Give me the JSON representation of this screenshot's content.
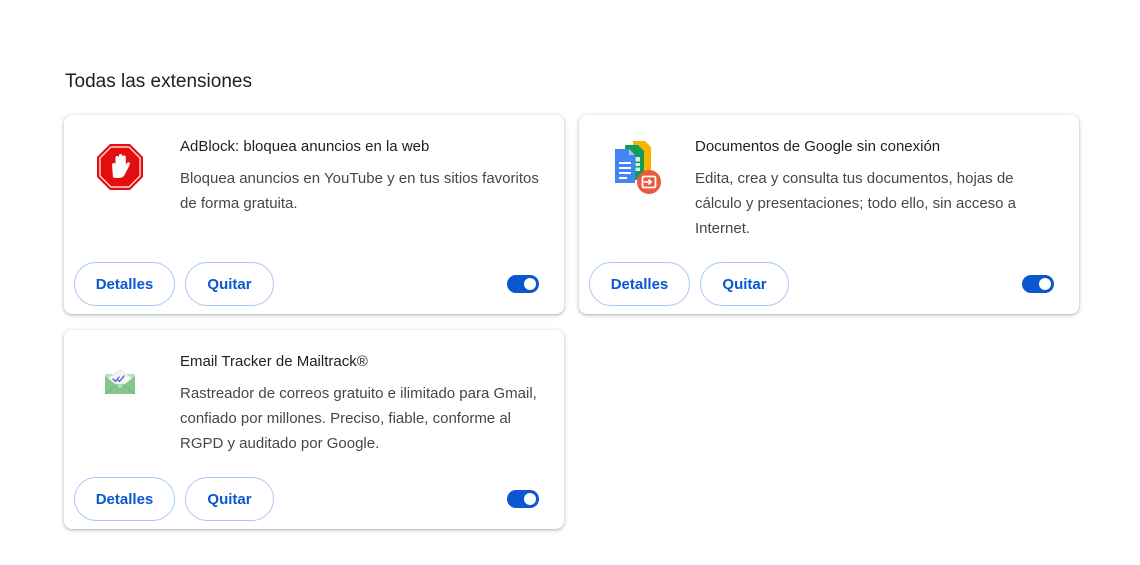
{
  "section": {
    "title": "Todas las extensiones"
  },
  "extensions": [
    {
      "name": "AdBlock: bloquea anuncios en la web",
      "description": "Bloquea anuncios en YouTube y en tus sitios favoritos de forma gratuita.",
      "icon": "adblock-stop-hand-icon",
      "details_label": "Detalles",
      "remove_label": "Quitar",
      "enabled": true
    },
    {
      "name": "Documentos de Google sin conexión",
      "description": "Edita, crea y consulta tus documentos, hojas de cálculo y presentaciones; todo ello, sin acceso a Internet.",
      "icon": "google-docs-offline-icon",
      "details_label": "Detalles",
      "remove_label": "Quitar",
      "enabled": true
    },
    {
      "name": "Email Tracker de Mailtrack®",
      "description": "Rastreador de correos gratuito e ilimitado para Gmail, confiado por millones. Preciso, fiable, conforme al RGPD y auditado por Google.",
      "icon": "mailtrack-envelope-icon",
      "details_label": "Detalles",
      "remove_label": "Quitar",
      "enabled": true
    }
  ],
  "colors": {
    "accent": "#0b57d0",
    "button_border": "#a8c7fa",
    "adblock_red": "#e40e0e",
    "mailtrack_green": "#86c68d"
  }
}
